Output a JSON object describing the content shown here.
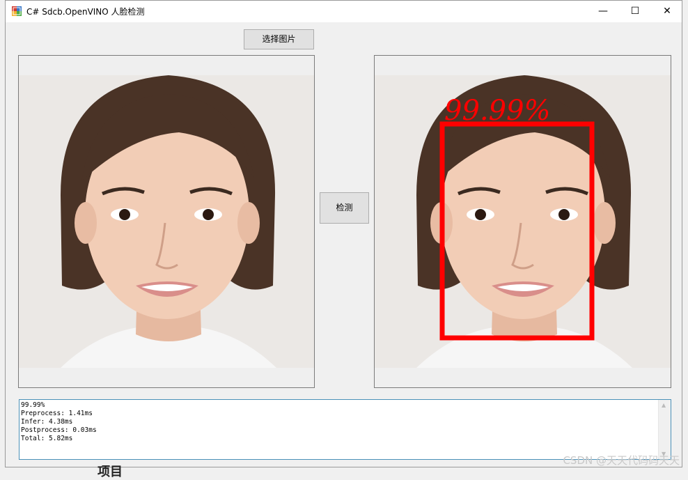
{
  "window": {
    "title": "C# Sdcb.OpenVINO 人脸检测",
    "controls": {
      "minimize": "—",
      "maximize": "☐",
      "close": "✕"
    }
  },
  "toolbar": {
    "select_image_label": "选择图片",
    "detect_label": "检测"
  },
  "detection": {
    "label": "99.99%",
    "box_color": "#ff0000"
  },
  "log": {
    "lines": [
      "99.99%",
      "Preprocess: 1.41ms",
      "Infer: 4.38ms",
      "Postprocess: 0.03ms",
      "Total: 5.82ms"
    ]
  },
  "watermark": "CSDN @天天代码码天天",
  "background_text": "项目"
}
